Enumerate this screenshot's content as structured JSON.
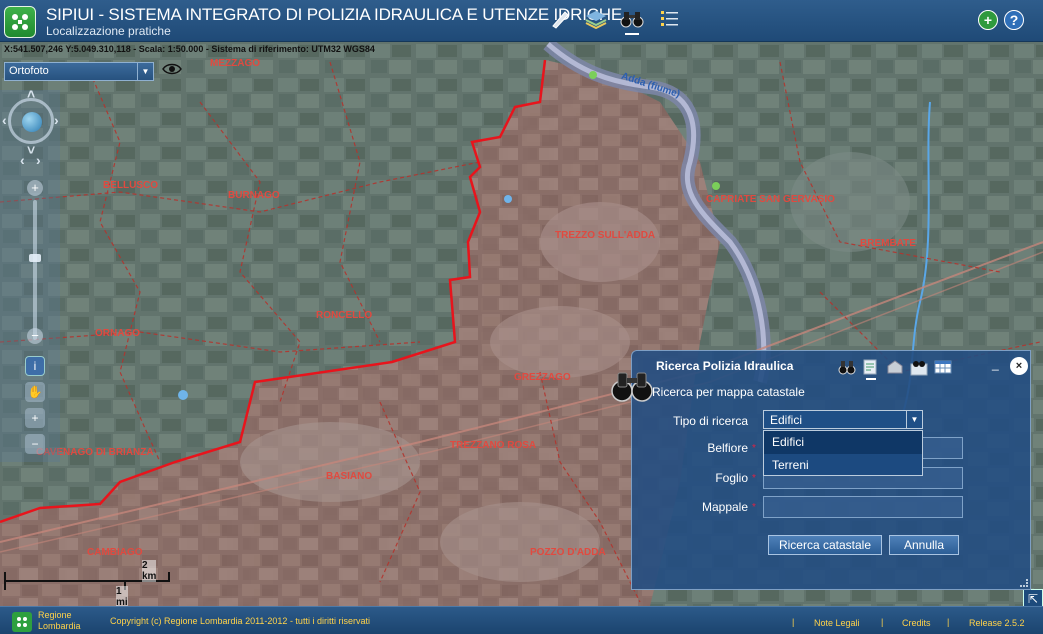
{
  "header": {
    "title": "SIPIUI - SISTEMA INTEGRATO DI POLIZIA IDRAULICA E UTENZE IDRICHE",
    "subtitle": "Localizzazione pratiche",
    "tools": [
      "pencil-icon",
      "layers-icon",
      "binoculars-icon",
      "list-icon"
    ],
    "active_tool": "binoculars-icon",
    "right_buttons": [
      "add-icon",
      "help-icon"
    ]
  },
  "map": {
    "coordinates": "X:541.507,246 Y:5.049.310,118 - Scala: 1:50.000 - Sistema di riferimento: UTM32 WGS84",
    "base_layer": "Ortofoto",
    "place_labels": [
      "MEZZAGO",
      "BELLUSCO",
      "BURNAGO",
      "RONCELLO",
      "ORNAGO",
      "TREZZO SULL'ADDA",
      "CAPRIATE SAN GERVASIO",
      "BREMBATE",
      "GREZZAGO",
      "TREZZANO ROSA",
      "BASIANO",
      "CAMBIAGO",
      "POZZO D'ADDA",
      "CAVENAGO DI BRIANZA",
      "Adda (fiume)"
    ],
    "scale": {
      "km": "2 km",
      "mi": "1 mi"
    }
  },
  "dialog": {
    "title": "Ricerca Polizia Idraulica",
    "heading": "Ricerca per mappa catastale",
    "fields": {
      "tipo_label": "Tipo di ricerca",
      "tipo_value": "Edifici",
      "belfiore_label": "Belfiore",
      "foglio_label": "Foglio",
      "mappale_label": "Mappale",
      "required_mark": "*"
    },
    "dropdown_options": [
      "Edifici",
      "Terreni"
    ],
    "buttons": {
      "search": "Ricerca catastale",
      "cancel": "Annulla"
    },
    "minimize": "_",
    "close": "×"
  },
  "footer": {
    "region": [
      "Regione",
      "Lombardia"
    ],
    "copyright": "Copyright (c) Regione Lombardia 2011-2012 - tutti i diritti riservati",
    "legal": "Note Legali",
    "credits": "Credits",
    "release": "Release 2.5.2",
    "separator": "|"
  },
  "colors": {
    "header": "#1f4a77",
    "boundary": "#e8141c",
    "dialog": "#244e82",
    "footer_text": "#ffd24a"
  }
}
